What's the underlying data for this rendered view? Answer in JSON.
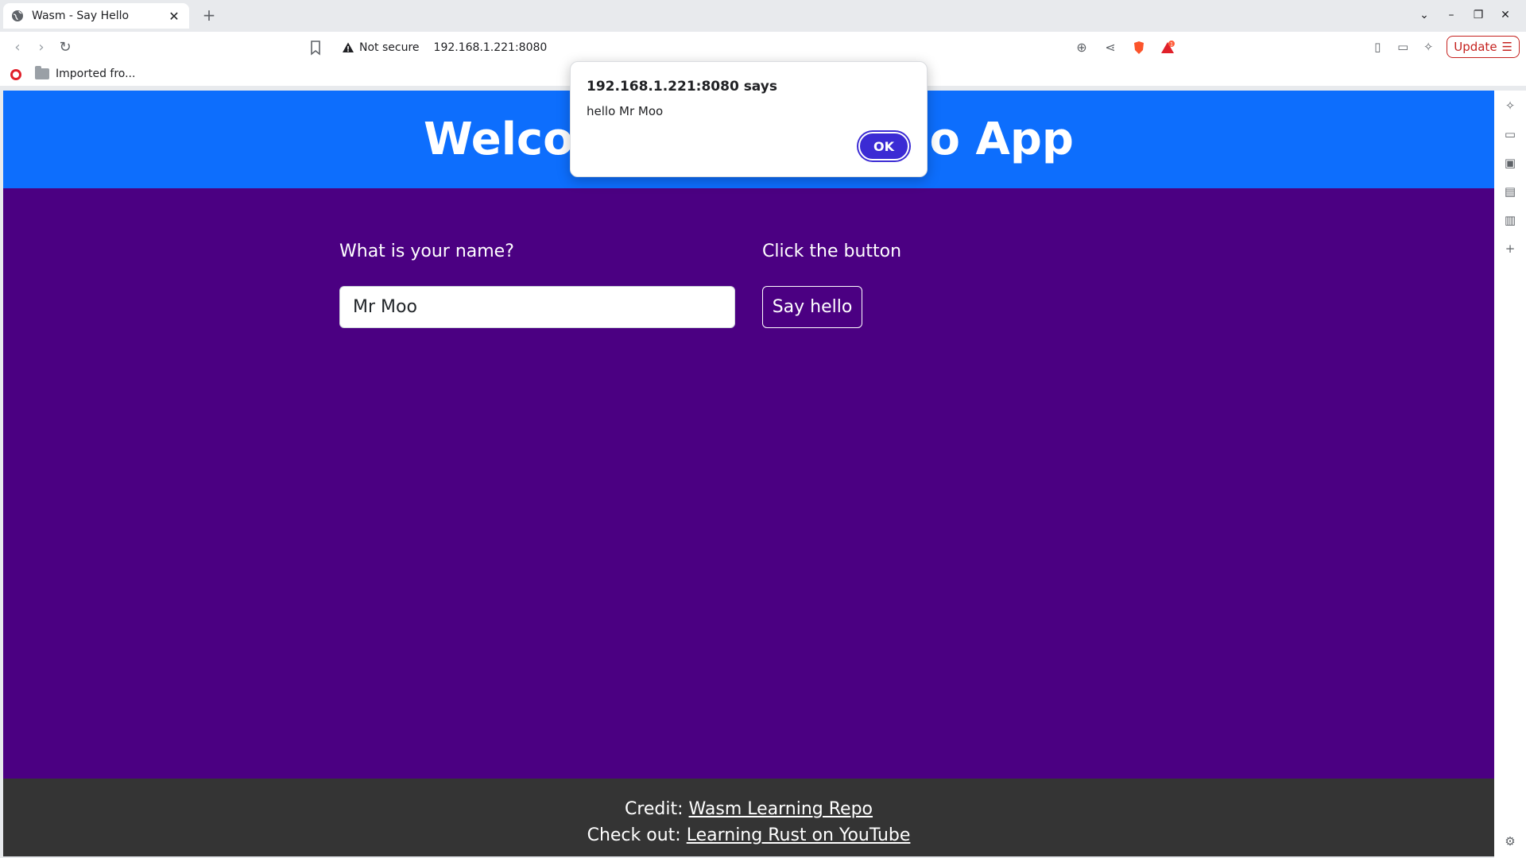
{
  "browser": {
    "tab_title": "Wasm - Say Hello",
    "tab_close": "✕",
    "new_tab": "+",
    "security_label": "Not secure",
    "url": "192.168.1.221:8080",
    "update_label": "Update",
    "bookmark_folder": "Imported fro...",
    "badge_count": "1"
  },
  "page": {
    "title": "Welcome to the Hello App",
    "name_label": "What is your name?",
    "name_value": "Mr Moo",
    "button_label": "Click the button",
    "button_text": "Say hello",
    "footer": {
      "credit_prefix": "Credit: ",
      "credit_link": "Wasm Learning Repo",
      "checkout_prefix": "Check out: ",
      "checkout_link": "Learning Rust on YouTube"
    }
  },
  "dialog": {
    "title": "192.168.1.221:8080 says",
    "message": "hello Mr Moo",
    "ok_label": "OK"
  },
  "colors": {
    "header_blue": "#0d6efd",
    "page_purple": "#4b0082",
    "footer_gray": "#343434",
    "ok_button": "#3b2bd4"
  }
}
